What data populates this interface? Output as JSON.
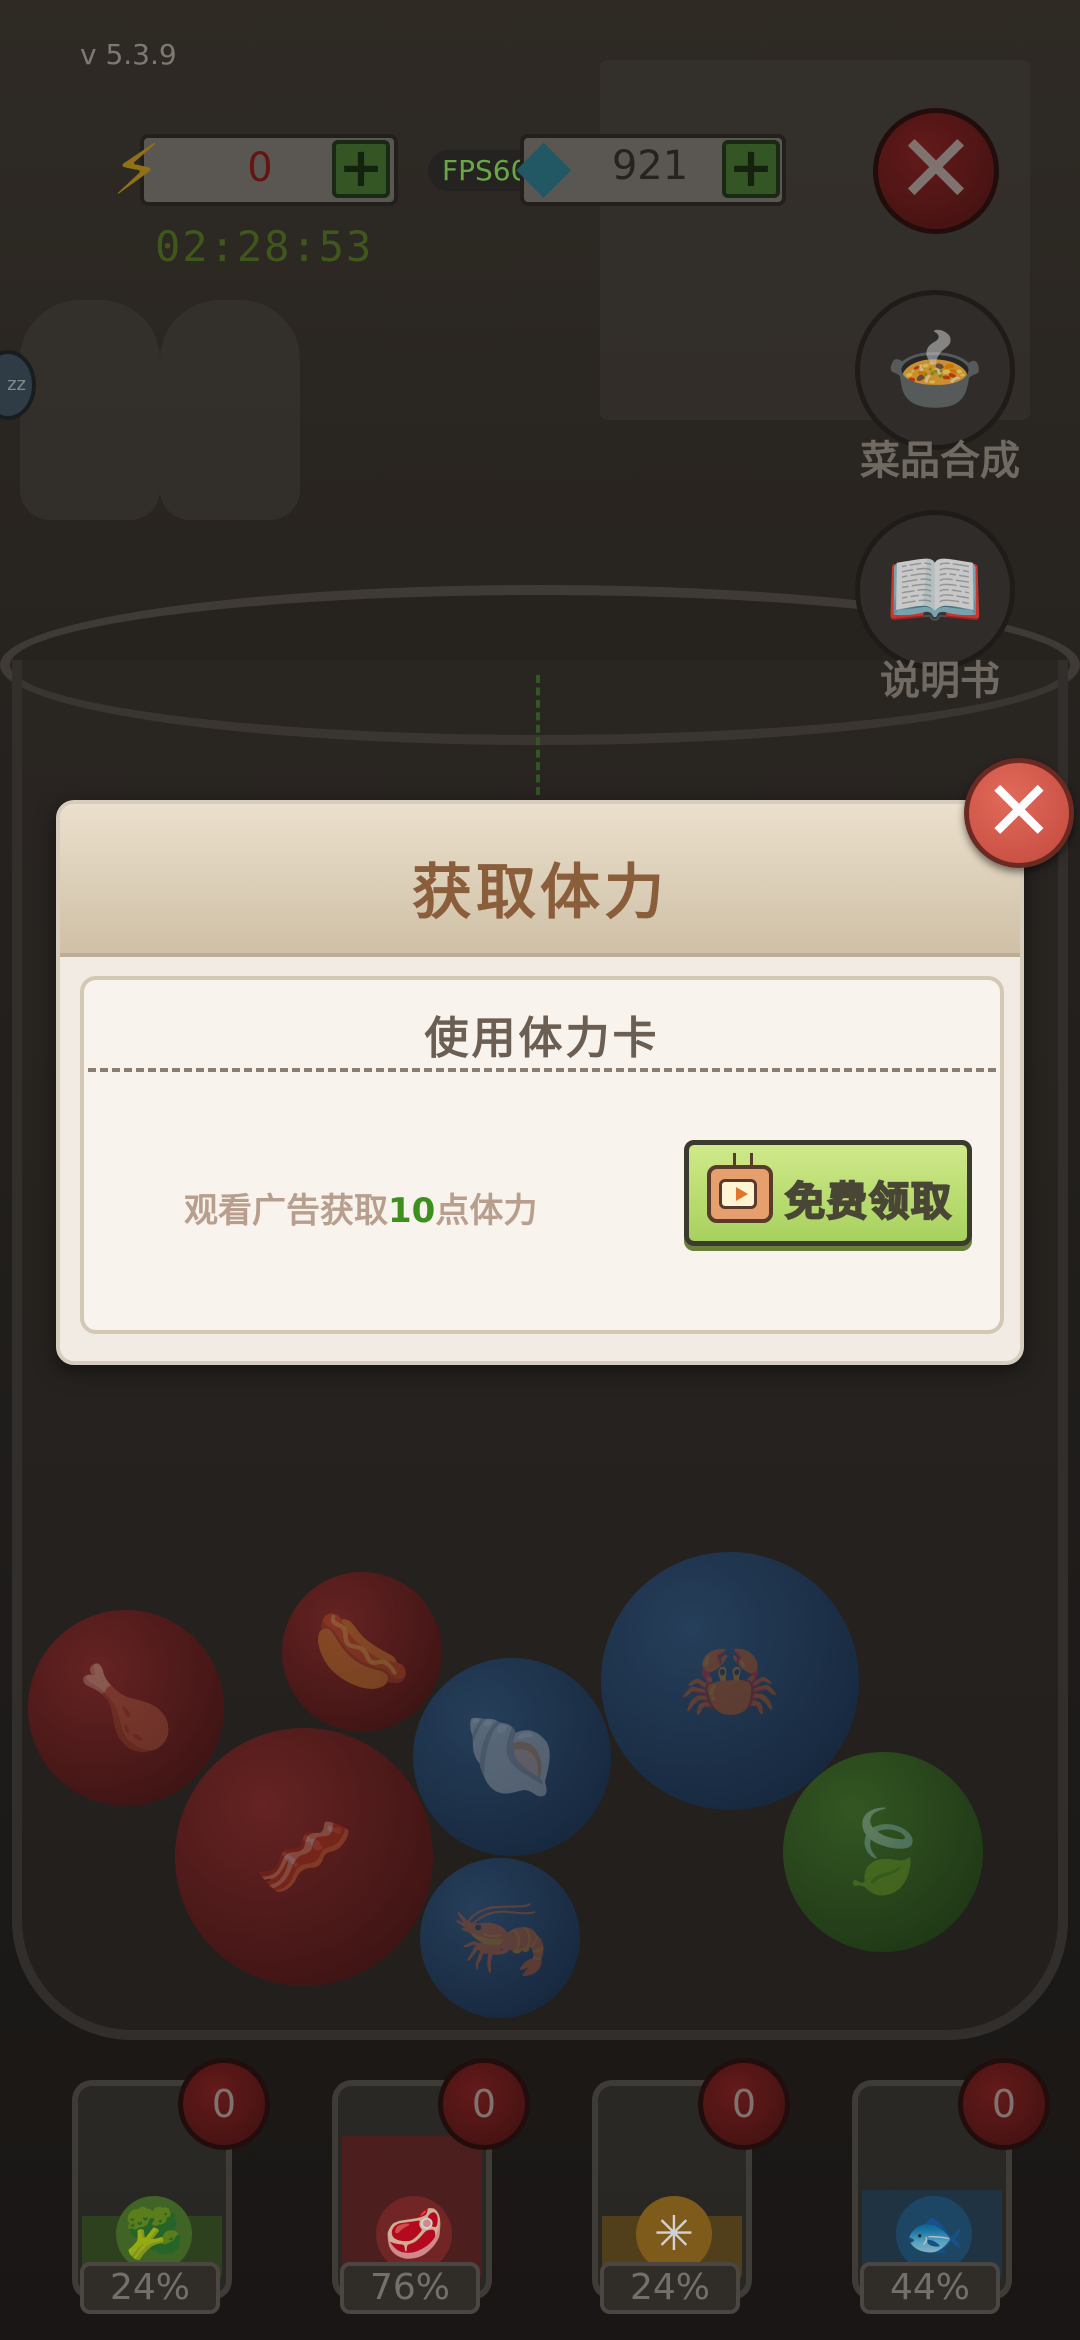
{
  "hud": {
    "version": "v  5.3.9",
    "energy_value": "0",
    "energy_timer": "02:28:53",
    "fps": "FPS60",
    "gems_value": "921",
    "plus": "+",
    "close": "✕"
  },
  "side": {
    "dish_merge_label": "菜品合成",
    "manual_label": "说明书",
    "zz": "zz"
  },
  "dialog": {
    "title": "获取体力",
    "card_title": "使用体力卡",
    "desc_prefix": "观看广告获取",
    "desc_number": "10",
    "desc_suffix": "点体力",
    "claim_label": "免费领取",
    "close": "✕"
  },
  "tubes": [
    {
      "count": "0",
      "percent": "24%",
      "color": "#3a6b25"
    },
    {
      "count": "0",
      "percent": "76%",
      "color": "#7a2222"
    },
    {
      "count": "0",
      "percent": "24%",
      "color": "#8a6418"
    },
    {
      "count": "0",
      "percent": "44%",
      "color": "#1f4a6b"
    }
  ]
}
